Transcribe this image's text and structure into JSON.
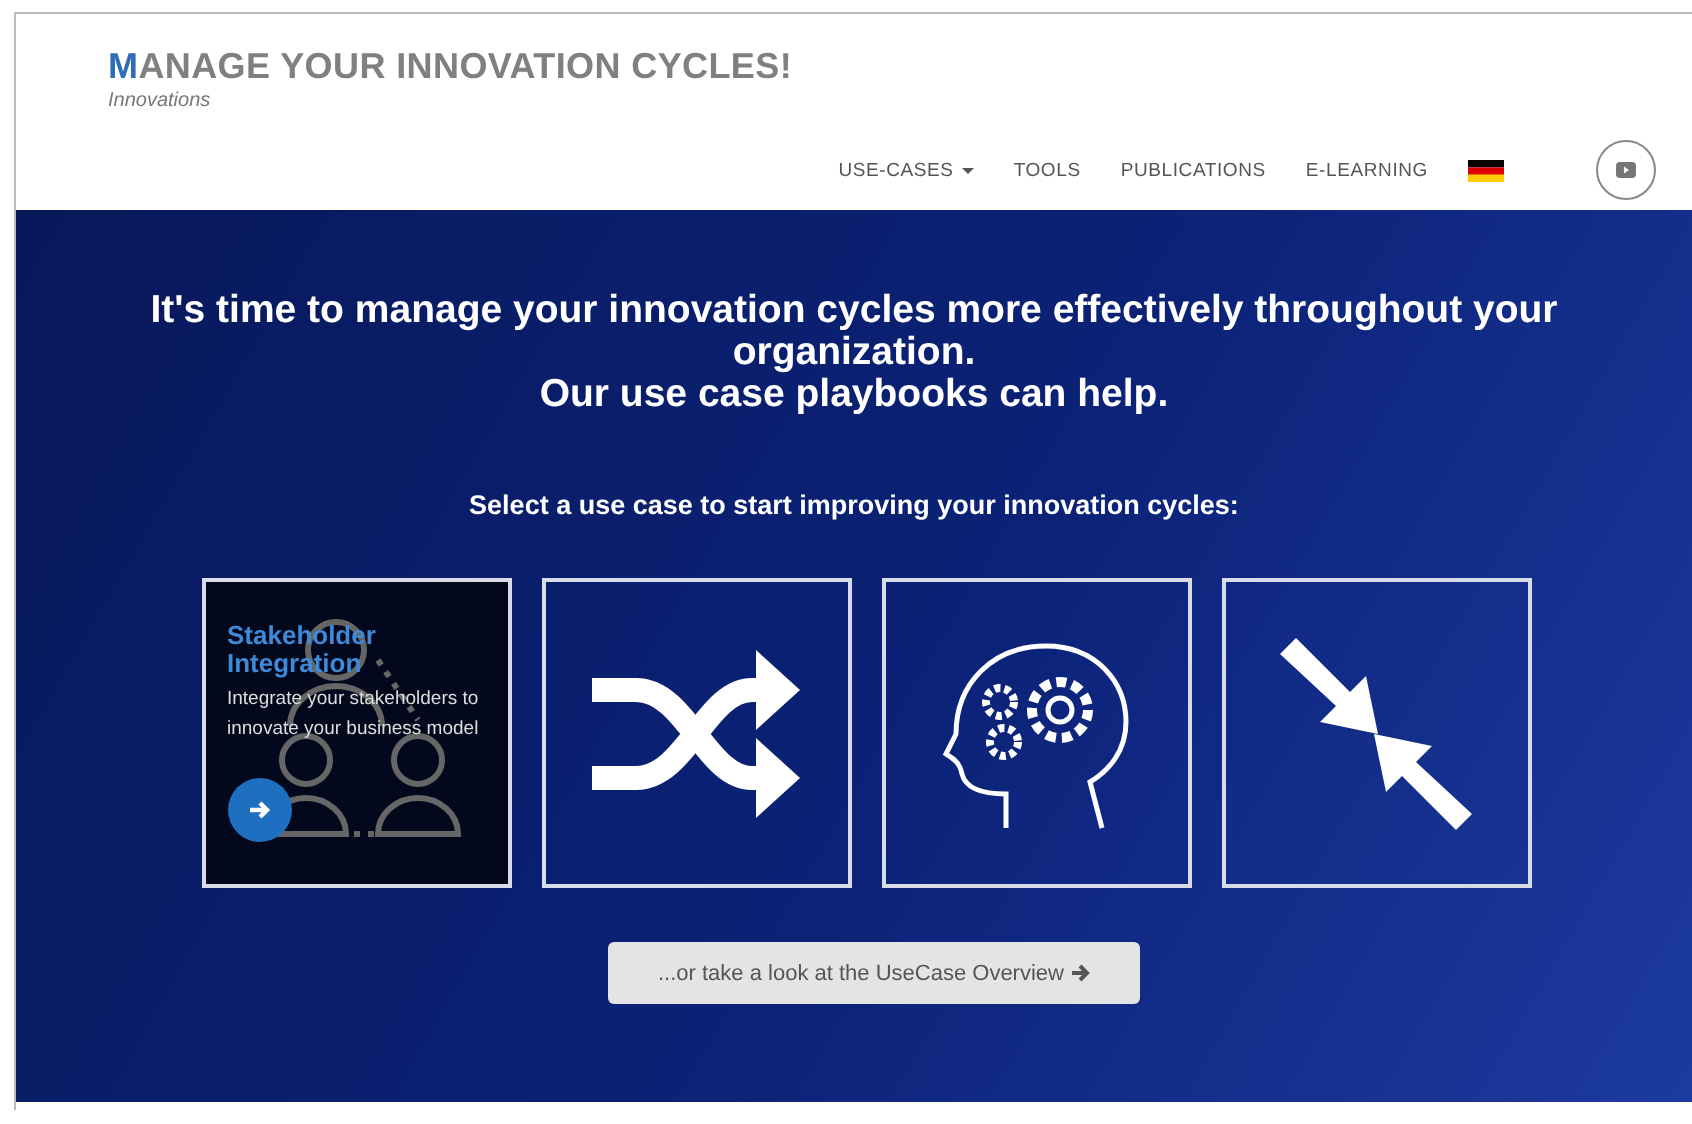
{
  "header": {
    "title": "MANAGE YOUR INNOVATION CYCLES!",
    "subtitle": "Innovations",
    "nav": [
      {
        "label": "USE-CASES",
        "dropdown": true
      },
      {
        "label": "TOOLS",
        "dropdown": false
      },
      {
        "label": "PUBLICATIONS",
        "dropdown": false
      },
      {
        "label": "E-LEARNING",
        "dropdown": false
      }
    ]
  },
  "hero": {
    "heading": [
      "It's time to manage your innovation cycles more effectively throughout your organization.",
      "Our use case playbooks can help."
    ],
    "prompt": "Select a use case to start improving your innovation cycles:",
    "cards": [
      {
        "kind": "description",
        "title": "Stakeholder Integration",
        "text": "Integrate your stakeholders to innovate your business model"
      },
      {
        "kind": "shuffle"
      },
      {
        "kind": "brain"
      },
      {
        "kind": "converge"
      }
    ],
    "overview_button": "...or take a look at the UseCase Overview"
  }
}
